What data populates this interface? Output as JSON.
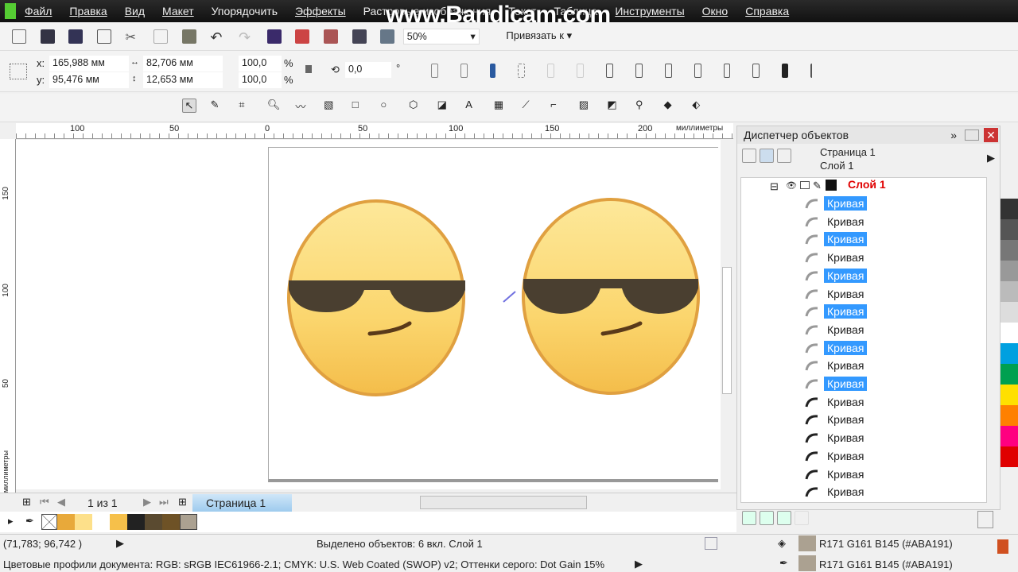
{
  "menu": [
    "Файл",
    "Правка",
    "Вид",
    "Макет",
    "Упорядочить",
    "Эффекты",
    "Растровые изображения",
    "Текст",
    "Таблица",
    "Инструменты",
    "Окно",
    "Справка"
  ],
  "watermark": "www.Bandicam.com",
  "toolbar": {
    "zoom": "50%",
    "snap": "Привязать к"
  },
  "props": {
    "x": "165,988 мм",
    "y": "95,476 мм",
    "w": "82,706 мм",
    "h": "12,653 мм",
    "sx": "100,0",
    "sy": "100,0",
    "pct": "%",
    "angle": "0,0",
    "deg": "°"
  },
  "ruler": {
    "ticks": [
      "100",
      "50",
      "0",
      "50",
      "100",
      "150",
      "200"
    ],
    "unit": "миллиметры",
    "vticks": [
      "150",
      "100",
      "50"
    ],
    "vunit": "миллиметры"
  },
  "object_manager": {
    "title": "Диспетчер объектов",
    "page": "Страница 1",
    "layer": "Слой 1",
    "layer_node": "Слой 1",
    "items": [
      {
        "label": "Кривая",
        "selected": true
      },
      {
        "label": "Кривая",
        "selected": false
      },
      {
        "label": "Кривая",
        "selected": true
      },
      {
        "label": "Кривая",
        "selected": false
      },
      {
        "label": "Кривая",
        "selected": true
      },
      {
        "label": "Кривая",
        "selected": false
      },
      {
        "label": "Кривая",
        "selected": true
      },
      {
        "label": "Кривая",
        "selected": false
      },
      {
        "label": "Кривая",
        "selected": true
      },
      {
        "label": "Кривая",
        "selected": false
      },
      {
        "label": "Кривая",
        "selected": true
      },
      {
        "label": "Кривая",
        "selected": false
      },
      {
        "label": "Кривая",
        "selected": false
      },
      {
        "label": "Кривая",
        "selected": false
      },
      {
        "label": "Кривая",
        "selected": false
      },
      {
        "label": "Кривая",
        "selected": false
      },
      {
        "label": "Кривая",
        "selected": false
      }
    ]
  },
  "pager": {
    "count": "1 из 1",
    "tab": "Страница 1"
  },
  "doc_palette": [
    "#e8a93a",
    "#fde08a",
    "#ffffff",
    "#f6c04a",
    "#222222",
    "#5a4a30",
    "#6e5226",
    "#aba191"
  ],
  "palette": [
    "#333333",
    "#555555",
    "#777777",
    "#999999",
    "#bbbbbb",
    "#dddddd",
    "#ffffff",
    "#00a0e0",
    "#00a050",
    "#ffe000",
    "#ff8000",
    "#ff0080",
    "#e00000"
  ],
  "status": {
    "coords": "(71,783; 96,742 )",
    "selection": "Выделено объектов: 6 вкл. Слой 1",
    "fill": "R171 G161 B145 (#ABA191)",
    "outline": "R171 G161 B145 (#ABA191)",
    "profiles": "Цветовые профили документа: RGB: sRGB IEC61966-2.1; CMYK: U.S. Web Coated (SWOP) v2; Оттенки серого: Dot Gain 15%"
  },
  "colors": {
    "selection": "#3399ff",
    "layer_red": "#e00000",
    "fill": "#aba191"
  }
}
